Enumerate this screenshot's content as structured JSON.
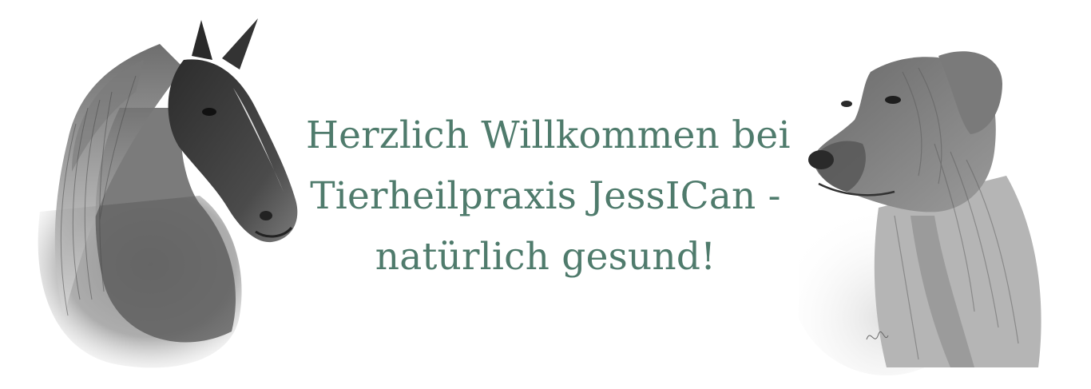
{
  "headline": {
    "lines": [
      "Herzlich Willkommen bei",
      "Tierheilpraxis JessICan -",
      "natürlich gesund!"
    ],
    "color": "#4f7b6c"
  },
  "images": {
    "left": "horse-portrait-pencil-drawing",
    "right": "dog-portrait-pencil-drawing"
  }
}
